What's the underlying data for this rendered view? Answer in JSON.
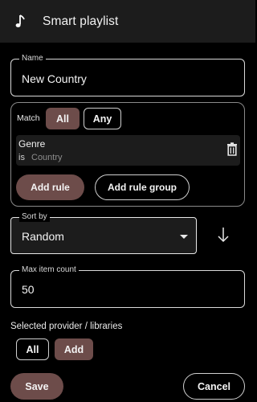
{
  "header": {
    "title": "Smart playlist",
    "icon": "music-note-icon"
  },
  "name_field": {
    "label": "Name",
    "value": "New Country"
  },
  "match": {
    "label": "Match",
    "options": [
      "All",
      "Any"
    ],
    "selected": "All",
    "rule": {
      "field": "Genre",
      "operator": "is",
      "value": "Country"
    },
    "add_rule_label": "Add rule",
    "add_rule_group_label": "Add rule group"
  },
  "sort": {
    "label": "Sort by",
    "value": "Random",
    "direction_icon": "arrow-down-icon"
  },
  "max_items": {
    "label": "Max item count",
    "value": "50"
  },
  "libraries": {
    "label": "Selected provider / libraries",
    "all_label": "All",
    "add_label": "Add"
  },
  "actions": {
    "save_label": "Save",
    "cancel_label": "Cancel"
  },
  "colors": {
    "accent": "#6d4c4a",
    "header_bg": "#1c1c1c",
    "background": "#000000"
  }
}
